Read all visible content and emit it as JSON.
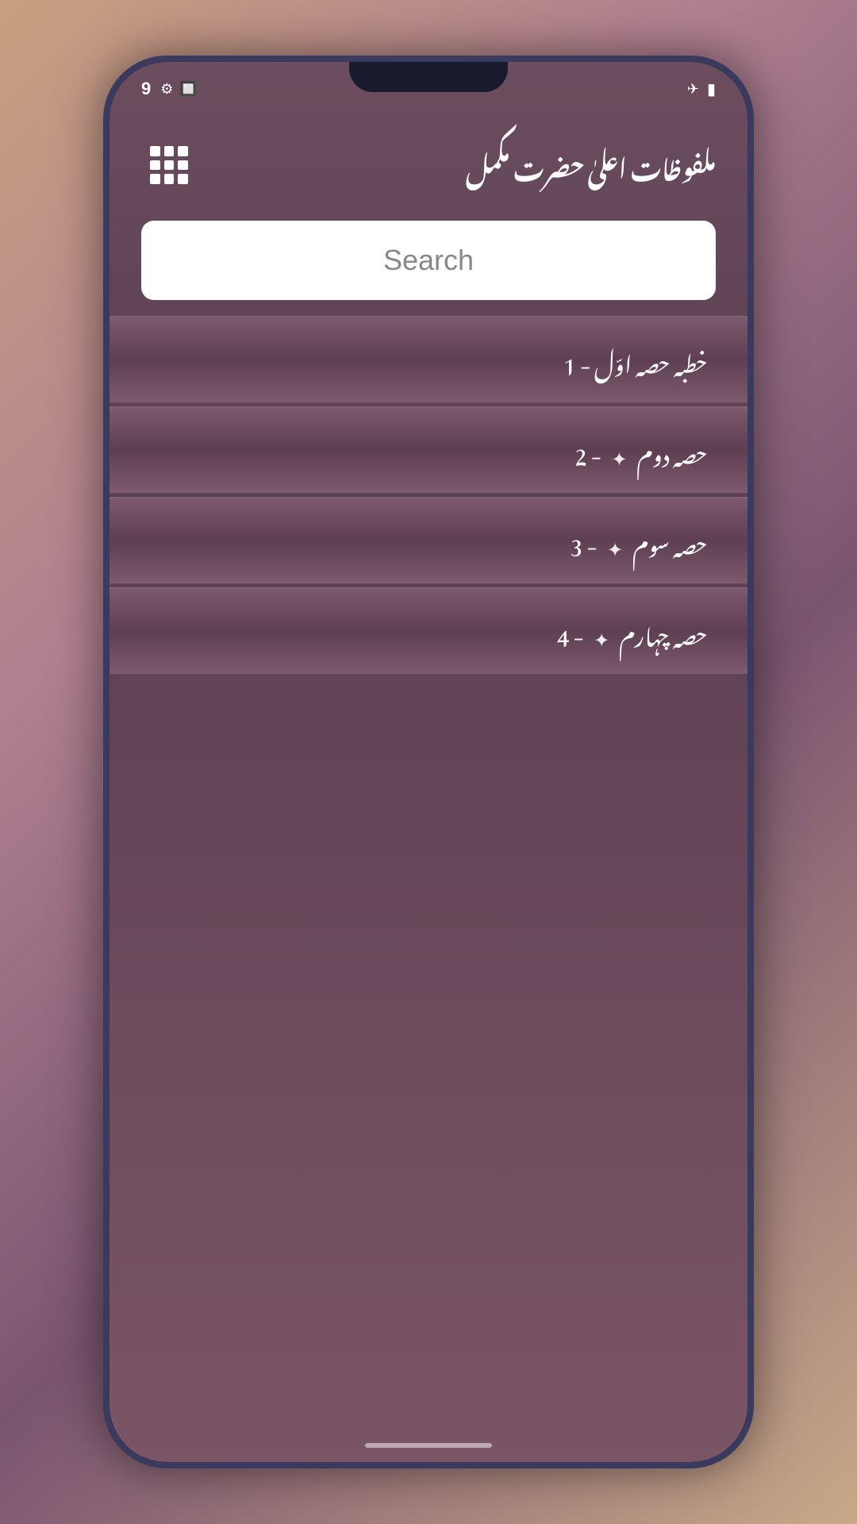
{
  "status_bar": {
    "time": "9",
    "icons": [
      "⚙",
      "🔲"
    ],
    "right_icons": [
      "✈",
      "🔋"
    ]
  },
  "header": {
    "title": "ملفوظات اعلیٰ حضرت مکمل",
    "grid_button_label": "Grid Menu"
  },
  "search": {
    "placeholder": "Search"
  },
  "list_items": [
    {
      "id": 1,
      "text": "خطبہ حصہ اوّل - 1",
      "has_star": false
    },
    {
      "id": 2,
      "text": "حصہ دوم ✿ - 2",
      "has_star": true,
      "star_char": "✿"
    },
    {
      "id": 3,
      "text": "حصہ سوم ✿ - 3",
      "has_star": true,
      "star_char": "✿"
    },
    {
      "id": 4,
      "text": "حصہ چہارم ✿ - 4",
      "has_star": true,
      "star_char": "✿"
    }
  ],
  "colors": {
    "background": "#6b4d5e",
    "list_item_bg": "#6e4560",
    "text_color": "#ffffff",
    "search_bg": "#ffffff"
  }
}
